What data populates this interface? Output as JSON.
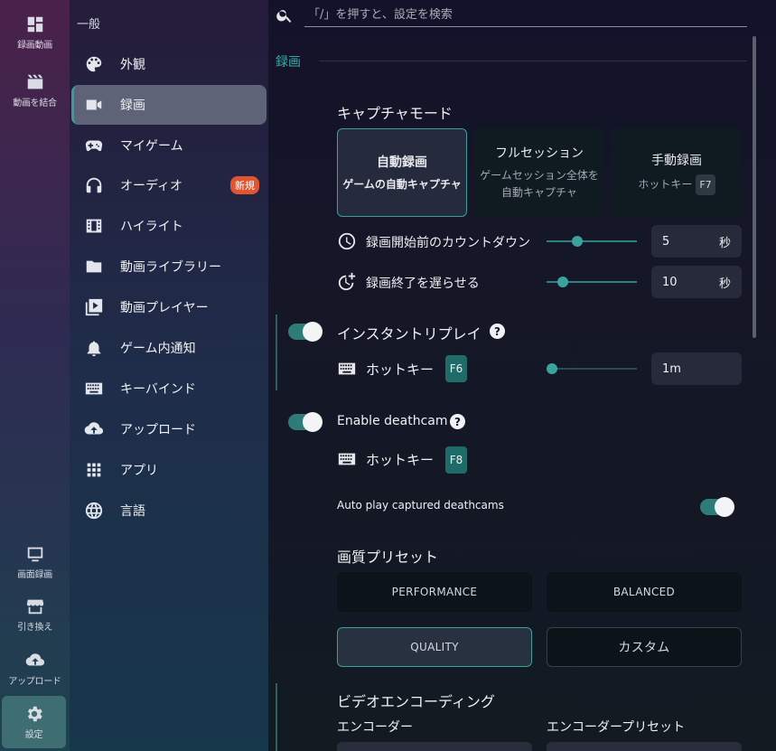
{
  "rail": {
    "items": [
      {
        "label": "録画動画",
        "icon": "dashboard-icon"
      },
      {
        "label": "動画を結合",
        "icon": "clapperboard-icon"
      },
      {
        "label": "画面録画",
        "icon": "screen-record-icon"
      },
      {
        "label": "引き換え",
        "icon": "store-icon"
      },
      {
        "label": "アップロード",
        "icon": "cloud-upload-icon"
      },
      {
        "label": "設定",
        "icon": "gear-icon"
      }
    ]
  },
  "nav": {
    "heading": "一般",
    "items": [
      {
        "label": "外観",
        "icon": "palette-icon"
      },
      {
        "label": "録画",
        "icon": "video-camera-icon"
      },
      {
        "label": "マイゲーム",
        "icon": "gamepad-icon"
      },
      {
        "label": "オーディオ",
        "icon": "headphones-icon",
        "badge": "新規"
      },
      {
        "label": "ハイライト",
        "icon": "film-strip-icon"
      },
      {
        "label": "動画ライブラリー",
        "icon": "folder-icon"
      },
      {
        "label": "動画プレイヤー",
        "icon": "video-library-icon"
      },
      {
        "label": "ゲーム内通知",
        "icon": "bell-icon"
      },
      {
        "label": "キーバインド",
        "icon": "keyboard-icon"
      },
      {
        "label": "アップロード",
        "icon": "cloud-upload-icon"
      },
      {
        "label": "アプリ",
        "icon": "apps-grid-icon"
      },
      {
        "label": "言語",
        "icon": "globe-icon"
      }
    ]
  },
  "search": {
    "placeholder": "「/」を押すと、設定を検索"
  },
  "section": {
    "title": "録画"
  },
  "capture": {
    "heading": "キャプチャモード",
    "modes": [
      {
        "title": "自動録画",
        "desc": "ゲームの自動キャプチャ",
        "selected": true
      },
      {
        "title": "フルセッション",
        "desc1": "ゲームセッション全体を",
        "desc2": "自動キャプチャ"
      },
      {
        "title": "手動録画",
        "desc": "ホットキー",
        "key": "F7"
      }
    ],
    "countdown": {
      "label": "録画開始前のカウントダウン",
      "value": "5",
      "unit": "秒",
      "icon": "clock-icon"
    },
    "delay": {
      "label": "録画終了を遅らせる",
      "value": "10",
      "unit": "秒",
      "icon": "clock-plus-icon"
    }
  },
  "instant_replay": {
    "label": "インスタントリプレイ",
    "help": "?",
    "hotkey_label": "ホットキー",
    "key": "F6",
    "duration": "1m",
    "enabled": true
  },
  "deathcam": {
    "label": "Enable deathcam",
    "help": "?",
    "hotkey_label": "ホットキー",
    "key": "F8",
    "enabled": true,
    "autoplay_label": "Auto play captured deathcams",
    "autoplay_enabled": true
  },
  "quality": {
    "heading": "画質プリセット",
    "presets": [
      {
        "label": "PERFORMANCE"
      },
      {
        "label": "BALANCED"
      },
      {
        "label": "QUALITY",
        "selected": true
      },
      {
        "label": "カスタム"
      }
    ]
  },
  "encoding": {
    "heading": "ビデオエンコーディング",
    "encoder_label": "エンコーダー",
    "preset_label": "エンコーダープリセット"
  },
  "colors": {
    "accent": "#3aa8a4",
    "badge": "#e0552f"
  }
}
